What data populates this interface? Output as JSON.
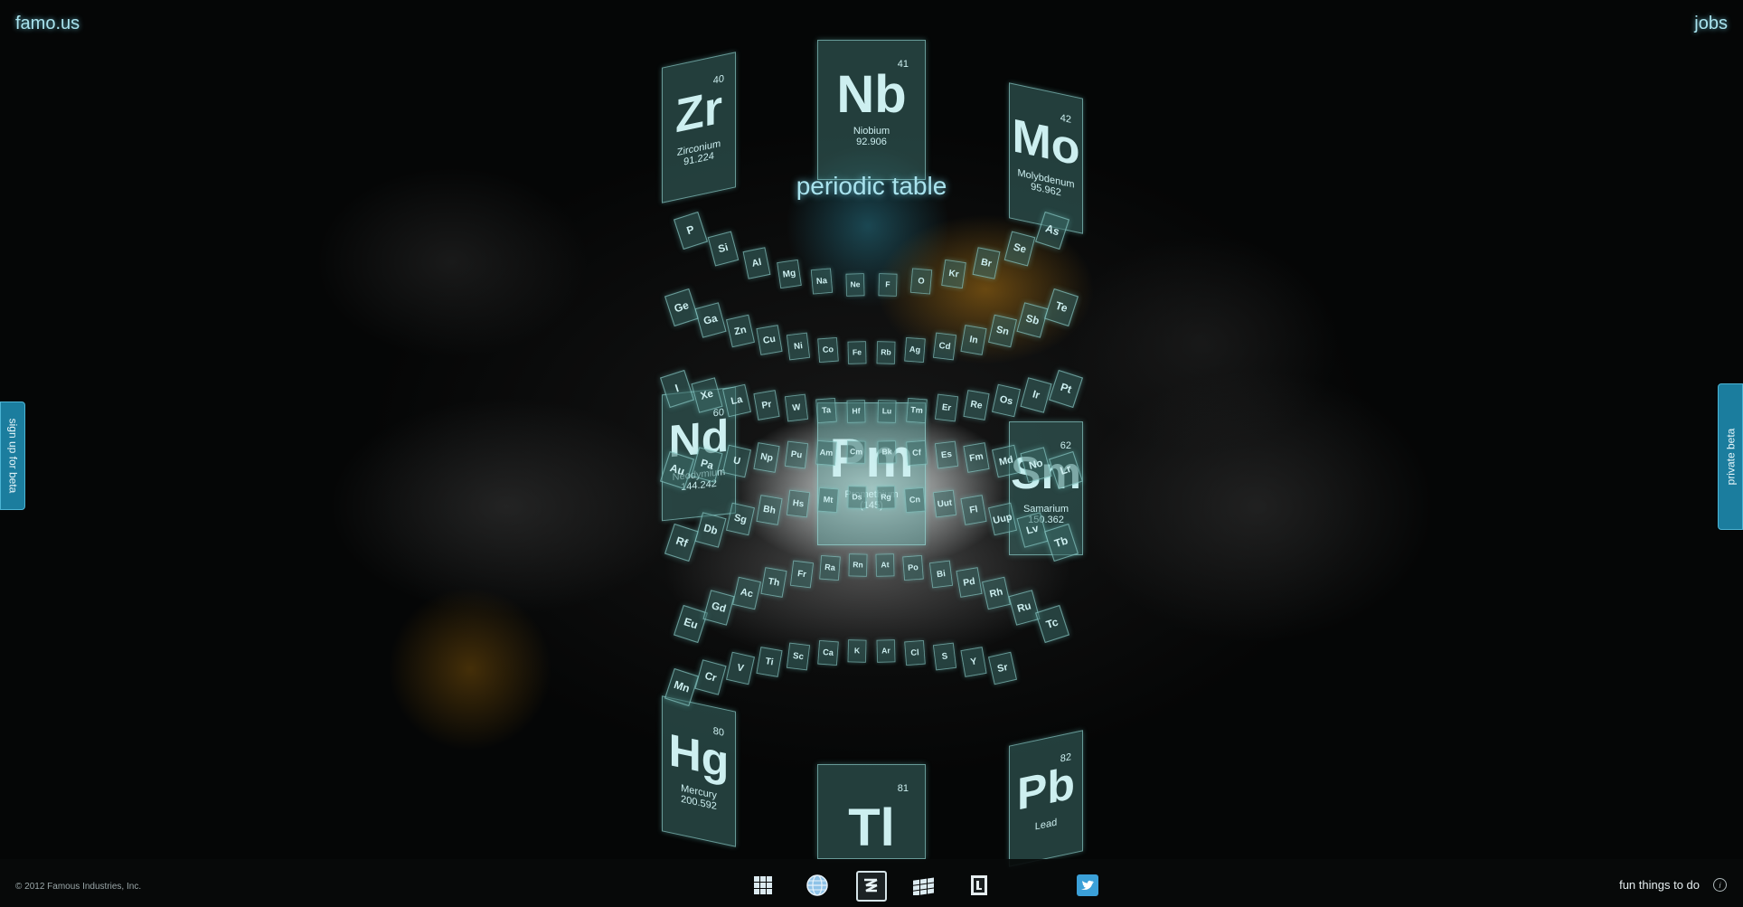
{
  "header": {
    "logo": "famo.us",
    "jobs": "jobs"
  },
  "side_tabs": {
    "left": "sign up for beta",
    "right": "private beta"
  },
  "demo": {
    "title": "periodic table",
    "featured": [
      {
        "symbol": "Nb",
        "number": "41",
        "name": "Niobium",
        "weight": "92.906"
      },
      {
        "symbol": "Zr",
        "number": "40",
        "name": "Zirconium",
        "weight": "91.224"
      },
      {
        "symbol": "Mo",
        "number": "42",
        "name": "Molybdenum",
        "weight": "95.962"
      },
      {
        "symbol": "Pm",
        "number": "",
        "name": "Promethium",
        "weight": "(145)"
      },
      {
        "symbol": "Nd",
        "number": "60",
        "name": "Neodymium",
        "weight": "144.242"
      },
      {
        "symbol": "Sm",
        "number": "62",
        "name": "Samarium",
        "weight": "150.362"
      },
      {
        "symbol": "Hg",
        "number": "80",
        "name": "Mercury",
        "weight": "200.592"
      },
      {
        "symbol": "Tl",
        "number": "81",
        "name": "",
        "weight": ""
      },
      {
        "symbol": "Pb",
        "number": "82",
        "name": "Lead",
        "weight": ""
      }
    ],
    "small_tiles": [
      "P",
      "Si",
      "Al",
      "Mg",
      "Na",
      "Ne",
      "F",
      "O",
      "Kr",
      "Br",
      "Se",
      "As",
      "Ge",
      "Ga",
      "Zn",
      "Cu",
      "Ni",
      "Co",
      "Fe",
      "Rb",
      "Ag",
      "Cd",
      "In",
      "Sn",
      "Sb",
      "Te",
      "I",
      "Xe",
      "La",
      "Pr",
      "W",
      "Ta",
      "Hf",
      "Lu",
      "Tm",
      "Er",
      "Re",
      "Os",
      "Ir",
      "Pt",
      "Au",
      "Pa",
      "U",
      "Np",
      "Pu",
      "Am",
      "Cm",
      "Bk",
      "Cf",
      "Es",
      "Fm",
      "Md",
      "No",
      "Lr",
      "Rf",
      "Db",
      "Sg",
      "Bh",
      "Hs",
      "Mt",
      "Ds",
      "Rg",
      "Cn",
      "Uut",
      "Fl",
      "Uup",
      "Lv",
      "Tb",
      "Eu",
      "Gd",
      "Ac",
      "Th",
      "Fr",
      "Ra",
      "Rn",
      "At",
      "Po",
      "Bi",
      "Pd",
      "Rh",
      "Ru",
      "Tc",
      "Mn",
      "Cr",
      "V",
      "Ti",
      "Sc",
      "Ca",
      "K",
      "Ar",
      "Cl",
      "S",
      "Y",
      "Sr"
    ]
  },
  "footer": {
    "copyright": "© 2012 Famous Industries, Inc.",
    "fun": "fun things to do",
    "icons": [
      "grid-icon",
      "globe-icon",
      "periodic-table-icon",
      "tiles-icon",
      "card-icon",
      "twitter-icon"
    ]
  }
}
